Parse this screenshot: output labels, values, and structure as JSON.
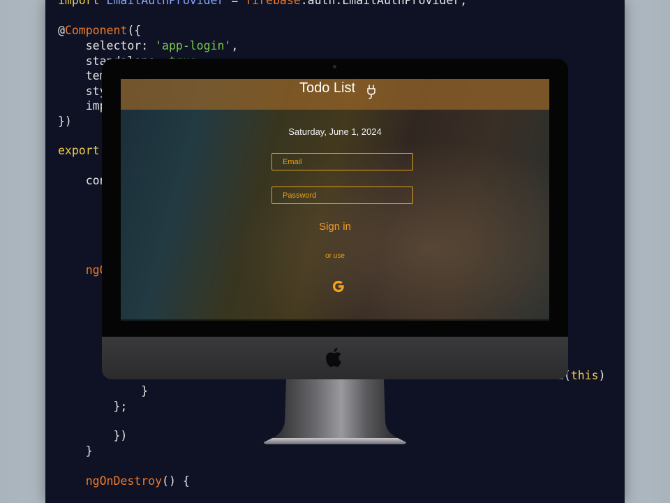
{
  "code": {
    "lines": [
      {
        "t": "import EmailAuthProvider = firebase.auth.EmailAuthProvider;"
      },
      {
        "t": "@Component({"
      },
      {
        "t": "    selector: 'app-login',"
      },
      {
        "t": "    standalone: true,"
      },
      {
        "t": "    tem"
      },
      {
        "t": "    sty"
      },
      {
        "t": "    imp"
      },
      {
        "t": "})"
      },
      {
        "t": "export"
      },
      {
        "t": "    con"
      },
      {
        "t": "    ngO"
      },
      {
        "t": "d(this)"
      },
      {
        "t": "            }"
      },
      {
        "t": "        };"
      },
      {
        "t": "    })"
      },
      {
        "t": "}"
      },
      {
        "t": "    ngOnDestroy() {"
      }
    ]
  },
  "app": {
    "title": "Todo List",
    "title_icon": "plug-icon",
    "date": "Saturday, June 1, 2024",
    "email_placeholder": "Email",
    "password_placeholder": "Password",
    "sign_in_label": "Sign in",
    "or_use_label": "or use",
    "google_icon": "google-icon",
    "accent_color": "#e3a21c"
  },
  "device": {
    "logo_icon": "apple-logo-icon"
  }
}
